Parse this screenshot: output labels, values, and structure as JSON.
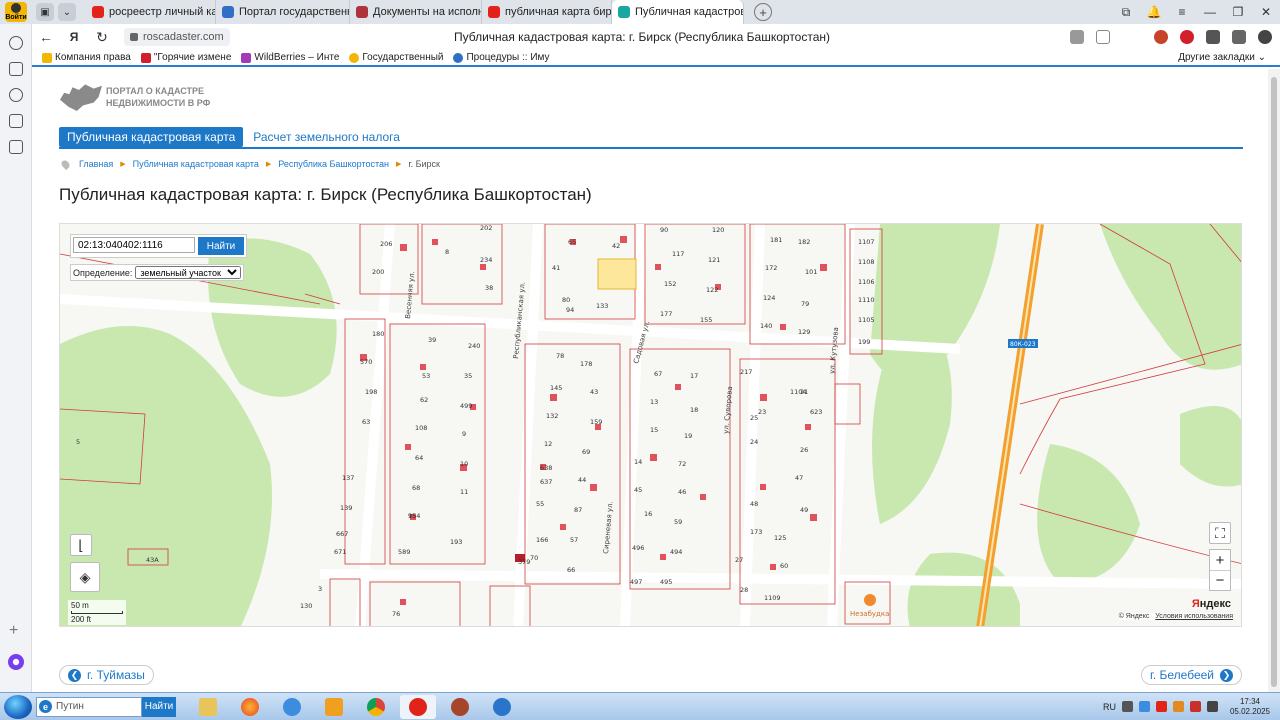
{
  "browser": {
    "badge": "Войти",
    "tabs": [
      {
        "label": "росреестр личный кабин",
        "color": "#e2231a"
      },
      {
        "label": "Портал государственных",
        "color": "#2f6fc8"
      },
      {
        "label": "Документы на исполнени",
        "color": "#b0323a"
      },
      {
        "label": "публичная карта бирск",
        "color": "#e2231a"
      },
      {
        "label": "Публичная кадастровая",
        "color": "#19a7a0",
        "active": true
      }
    ],
    "url": "roscadaster.com",
    "page_title": "Публичная кадастровая карта: г. Бирск (Республика Башкортостан)",
    "bookmarks": [
      {
        "label": "Компания права",
        "color": "#f2b705"
      },
      {
        "label": "\"Горячие измене",
        "color": "#d21f2b"
      },
      {
        "label": "WildBerries – Инте",
        "color": "#a23bb8"
      },
      {
        "label": "Государственный",
        "color": "#f2b705"
      },
      {
        "label": "Процедуры :: Иму",
        "color": "#2f6fc8"
      }
    ],
    "other_bookmarks": "Другие закладки"
  },
  "site": {
    "logo_line1": "ПОРТАЛ О КАДАСТРЕ",
    "logo_line2": "НЕДВИЖИМОСТИ В РФ",
    "nav_active": "Публичная кадастровая карта",
    "nav_tax": "Расчет земельного налога",
    "breadcrumb": [
      "Главная",
      "Публичная кадастровая карта",
      "Республика Башкортостан"
    ],
    "breadcrumb_current": "г. Бирск",
    "title": "Публичная кадастровая карта: г. Бирск (Республика Башкортостан)"
  },
  "map": {
    "search_value": "02:13:040402:1116",
    "search_button": "Найти",
    "definition_label": "Определение:",
    "definition_value": "земельный участок",
    "scale_m": "50 m",
    "scale_ft": "200 ft",
    "brand": "Яндекс",
    "copyright": "© Яндекс",
    "terms": "Условия использования",
    "road_badge": "80К-023",
    "shop_label": "Незабудка",
    "streets": [
      "Весенняя ул.",
      "Республиканская ул.",
      "Сиреневая ул.",
      "Садовая ул.",
      "ул. Суворова",
      "ул. Кутузова"
    ],
    "parcels": [
      "206",
      "200",
      "8",
      "234",
      "38",
      "202",
      "65",
      "42",
      "41",
      "80",
      "133",
      "94",
      "90",
      "117",
      "152",
      "177",
      "120",
      "121",
      "122",
      "155",
      "181",
      "182",
      "172",
      "101",
      "124",
      "79",
      "140",
      "129",
      "1107",
      "1108",
      "1106",
      "1110",
      "1105",
      "199",
      "180",
      "570",
      "198",
      "63",
      "39",
      "240",
      "53",
      "35",
      "62",
      "499",
      "108",
      "9",
      "64",
      "10",
      "68",
      "11",
      "154",
      "95",
      "193",
      "589",
      "137",
      "139",
      "667",
      "671",
      "78",
      "145",
      "178",
      "43",
      "132",
      "159",
      "12",
      "69",
      "638",
      "637",
      "44",
      "55",
      "87",
      "166",
      "57",
      "70",
      "66",
      "379",
      "67",
      "13",
      "15",
      "17",
      "18",
      "19",
      "14",
      "72",
      "45",
      "46",
      "16",
      "59",
      "496",
      "494",
      "497",
      "495",
      "217",
      "25",
      "23",
      "21",
      "24",
      "26",
      "47",
      "48",
      "49",
      "173",
      "125",
      "27",
      "60",
      "28",
      "1109",
      "1104",
      "623",
      "5",
      "43A",
      "3",
      "130",
      "76"
    ]
  },
  "pager": {
    "prev": "г. Туймазы",
    "next": "г. Белебеей"
  },
  "taskbar": {
    "search_placeholder": "Путин",
    "search_button": "Найти",
    "lang": "RU",
    "time": "17:34",
    "date": "05.02.2025"
  }
}
